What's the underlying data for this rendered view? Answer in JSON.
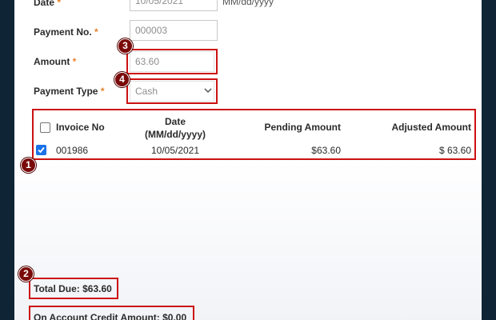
{
  "form": {
    "date": {
      "label": "Date",
      "required_mark": "*",
      "value": "10/05/2021",
      "format_hint": "MM/dd/yyyy"
    },
    "payment_no": {
      "label": "Payment No.",
      "required_mark": "*",
      "value": "000003"
    },
    "amount": {
      "label": "Amount",
      "required_mark": "*",
      "value": "63.60"
    },
    "payment_type": {
      "label": "Payment Type",
      "required_mark": "*",
      "selected": "Cash"
    }
  },
  "table": {
    "headers": {
      "invoice_no": "Invoice No",
      "date_line1": "Date",
      "date_line2": "(MM/dd/yyyy)",
      "pending_amount": "Pending Amount",
      "adjusted_amount": "Adjusted Amount"
    },
    "rows": [
      {
        "checked": true,
        "invoice_no": "001986",
        "date": "10/05/2021",
        "pending_amount": "$63.60",
        "adjusted_amount": "$ 63.60"
      }
    ]
  },
  "totals": {
    "total_due": "Total Due: $63.60",
    "on_account_credit": "On Account Credit Amount: $0.00"
  },
  "annotations": {
    "badge_1": "1",
    "badge_2": "2",
    "badge_3": "3",
    "badge_4": "4"
  },
  "colors": {
    "highlight": "#cc1111",
    "required": "#e8822c",
    "badge": "#7a0a0a",
    "checkbox_checked": "#1a73e8",
    "background": "#0f2535"
  }
}
